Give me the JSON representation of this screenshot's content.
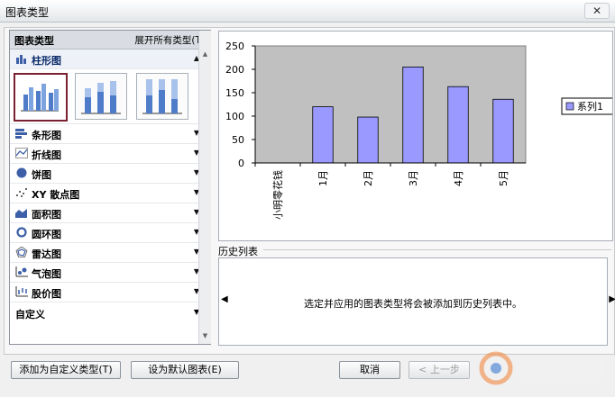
{
  "window": {
    "title": "图表类型",
    "close_glyph": "✕"
  },
  "left_panel": {
    "header": "图表类型",
    "expand_all": "展开所有类型(T)",
    "categories": [
      {
        "label": "柱形图",
        "icon": "column-chart-icon",
        "expanded": true
      },
      {
        "label": "条形图",
        "icon": "bar-chart-icon"
      },
      {
        "label": "折线图",
        "icon": "line-chart-icon"
      },
      {
        "label": "饼图",
        "icon": "pie-chart-icon"
      },
      {
        "label": "XY 散点图",
        "icon": "scatter-chart-icon"
      },
      {
        "label": "面积图",
        "icon": "area-chart-icon"
      },
      {
        "label": "圆环图",
        "icon": "doughnut-chart-icon"
      },
      {
        "label": "雷达图",
        "icon": "radar-chart-icon"
      },
      {
        "label": "气泡图",
        "icon": "bubble-chart-icon"
      },
      {
        "label": "股价图",
        "icon": "stock-chart-icon"
      }
    ],
    "custom": "自定义",
    "arrow_up": "▲",
    "arrow_down": "▼"
  },
  "chart_data": {
    "type": "bar",
    "categories": [
      "小明零花钱",
      "1月",
      "2月",
      "3月",
      "4月",
      "5月"
    ],
    "series": [
      {
        "name": "系列1",
        "values": [
          0,
          120,
          98,
          205,
          163,
          136
        ]
      }
    ],
    "ylim": [
      0,
      250
    ],
    "yticks": [
      0,
      50,
      100,
      150,
      200,
      250
    ],
    "grid": false,
    "legend": "right",
    "bar_color": "#9999ff",
    "plot_bg": "#c0c0c0"
  },
  "history": {
    "label": "历史列表",
    "message": "选定并应用的图表类型将会被添加到历史列表中。",
    "left_arrow": "◀",
    "right_arrow": "▶"
  },
  "buttons": {
    "add_custom": "添加为自定义类型(T)",
    "set_default": "设为默认图表(E)",
    "cancel": "取消",
    "prev": "< 上一步"
  },
  "colors": {
    "accent_border": "#7a2030",
    "bar": "#9999ff"
  }
}
